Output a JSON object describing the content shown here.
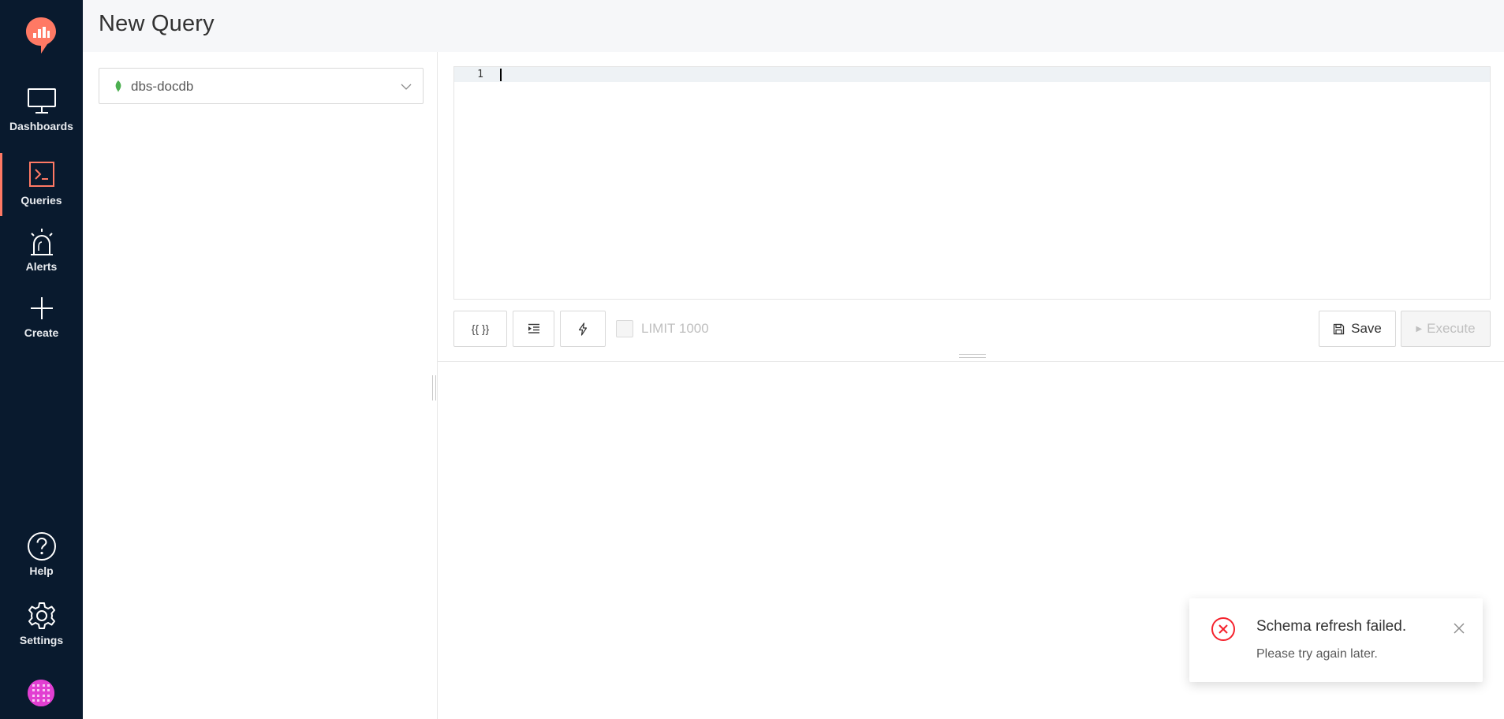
{
  "colors": {
    "sidebar_bg": "#091a2e",
    "accent": "#ff7964",
    "error": "#f5222d",
    "datasource_icon": "#4caf50",
    "avatar": "#e23fd2"
  },
  "sidebar": {
    "logo_icon": "redash-logo-icon",
    "items": [
      {
        "label": "Dashboards",
        "icon": "monitor-icon",
        "active": false
      },
      {
        "label": "Queries",
        "icon": "terminal-icon",
        "active": true
      },
      {
        "label": "Alerts",
        "icon": "siren-icon",
        "active": false
      },
      {
        "label": "Create",
        "icon": "plus-icon",
        "active": false
      }
    ],
    "bottom_items": [
      {
        "label": "Help",
        "icon": "question-icon"
      },
      {
        "label": "Settings",
        "icon": "gear-icon"
      }
    ],
    "avatar_icon": "user-avatar-icon"
  },
  "header": {
    "title": "New Query"
  },
  "datasource": {
    "selected": "dbs-docdb",
    "icon": "leaf-icon"
  },
  "editor": {
    "line_numbers": [
      "1"
    ],
    "content": ""
  },
  "toolbar": {
    "params_label": "{{ }}",
    "format_icon": "indent-icon",
    "autocomplete_icon": "lightning-icon",
    "limit_label": "LIMIT 1000",
    "limit_checked": false,
    "save_label": "Save",
    "execute_label": "Execute"
  },
  "notification": {
    "title": "Schema refresh failed.",
    "description": "Please try again later."
  }
}
